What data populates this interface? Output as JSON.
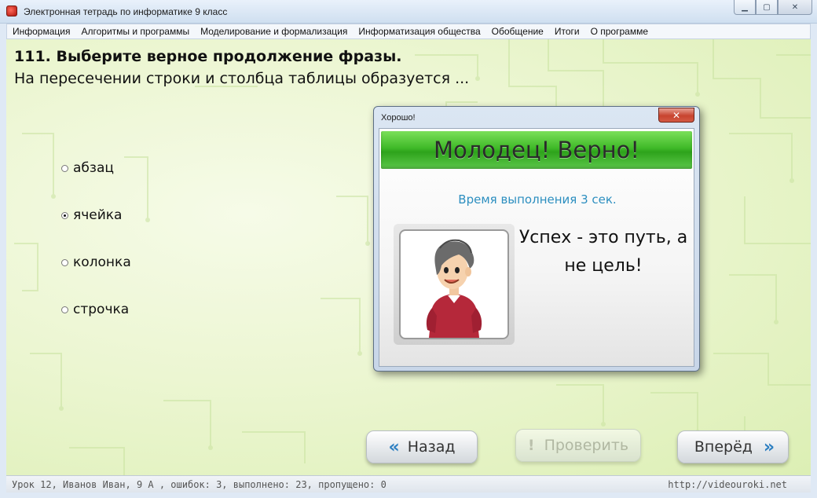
{
  "window": {
    "title": "Электронная тетрадь по информатике 9 класс",
    "controls": {
      "minimize": "▁",
      "maximize": "▢",
      "close": "✕"
    }
  },
  "menu": {
    "items": [
      "Информация",
      "Алгоритмы и программы",
      "Моделирование и формализация",
      "Информатизация общества",
      "Обобщение",
      "Итоги",
      "О программе"
    ]
  },
  "question": {
    "title": "111. Выберите верное продолжение фразы.",
    "text": "На пересечении строки и столбца таблицы образуется ...",
    "options": [
      {
        "label": "абзац",
        "selected": false
      },
      {
        "label": "ячейка",
        "selected": true
      },
      {
        "label": "колонка",
        "selected": false
      },
      {
        "label": "строчка",
        "selected": false
      }
    ]
  },
  "navigation": {
    "back_label": "Назад",
    "check_label": "Проверить",
    "forward_label": "Вперёд",
    "back_icon": "«",
    "check_icon": "!",
    "forward_icon": "»"
  },
  "dialog": {
    "title": "Хорошо!",
    "close_icon": "✕",
    "banner": "Молодец! Верно!",
    "time_text": "Время выполнения 3 сек.",
    "quote_line1": "Успех - это путь, а",
    "quote_line2": "не цель!",
    "avatar_icon": "cartoon-person"
  },
  "status": {
    "left": "Урок 12, Иванов Иван, 9 А , ошибок: 3, выполнено: 23, пропущено: 0",
    "right": "http://videouroki.net"
  },
  "colors": {
    "accent": "#2d8fc0",
    "banner_green": "#3fb928",
    "background": "#ecf6d2"
  }
}
